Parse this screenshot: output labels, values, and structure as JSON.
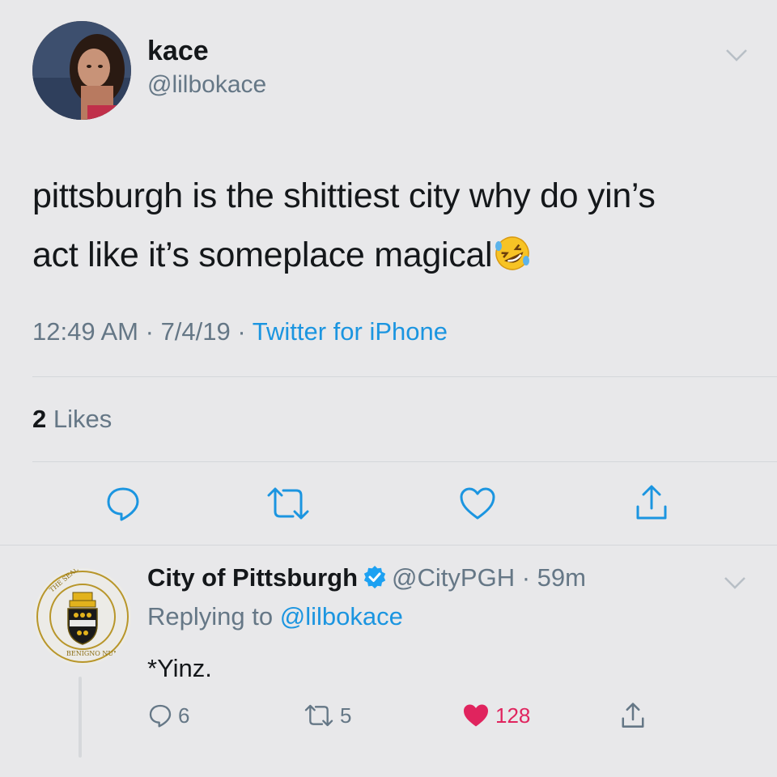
{
  "tweet": {
    "display_name": "kace",
    "handle": "@lilbokace",
    "text_line1": "pittsburgh is the shittiest city why do yin’s",
    "text_line2": "act like it’s someplace magical",
    "emoji": "rolling-on-floor-laughing",
    "time": "12:49 AM",
    "date": "7/4/19",
    "separator": "·",
    "source": "Twitter for iPhone",
    "likes_count": "2",
    "likes_label": "Likes"
  },
  "reply": {
    "display_name": "City of Pittsburgh",
    "handle": "@CityPGH",
    "separator": "·",
    "age": "59m",
    "replying_prefix": "Replying to",
    "replying_to": "@lilbokace",
    "text": "*Yinz.",
    "reply_count": "6",
    "retweet_count": "5",
    "like_count": "128",
    "seal_text": "THE SEAL OF THE CITY OF PITTSBURGH · BENIGNO NUMINE · 1816"
  },
  "colors": {
    "background": "#e8e8ea",
    "text": "#14171a",
    "secondary": "#657786",
    "link": "#1b95e0",
    "like": "#e0245e",
    "verified": "#1da1f2"
  },
  "icons": [
    "chevron-down-icon",
    "reply-icon",
    "retweet-icon",
    "heart-icon",
    "share-icon",
    "verified-badge-icon"
  ]
}
